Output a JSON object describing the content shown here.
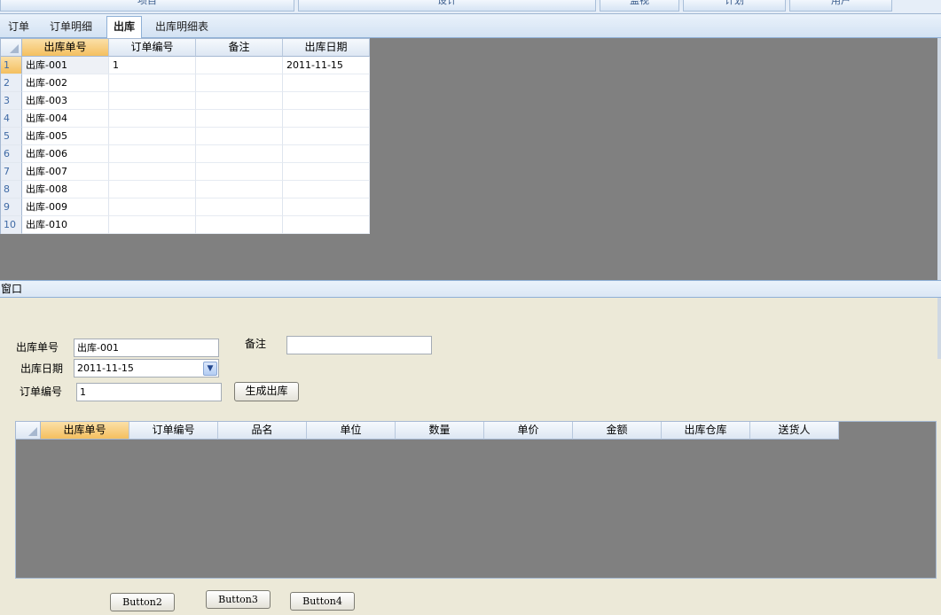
{
  "top_menu": [
    "项目",
    "设计",
    "监视",
    "计划",
    "用户"
  ],
  "tabs": [
    "订单",
    "订单明细",
    "出库",
    "出库明细表"
  ],
  "active_tab": "出库",
  "grid1": {
    "columns": [
      "出库单号",
      "订单编号",
      "备注",
      "出库日期"
    ],
    "rows": [
      {
        "num": "1",
        "cells": [
          "出库-001",
          "1",
          "",
          "2011-11-15"
        ]
      },
      {
        "num": "2",
        "cells": [
          "出库-002",
          "",
          "",
          ""
        ]
      },
      {
        "num": "3",
        "cells": [
          "出库-003",
          "",
          "",
          ""
        ]
      },
      {
        "num": "4",
        "cells": [
          "出库-004",
          "",
          "",
          ""
        ]
      },
      {
        "num": "5",
        "cells": [
          "出库-005",
          "",
          "",
          ""
        ]
      },
      {
        "num": "6",
        "cells": [
          "出库-006",
          "",
          "",
          ""
        ]
      },
      {
        "num": "7",
        "cells": [
          "出库-007",
          "",
          "",
          ""
        ]
      },
      {
        "num": "8",
        "cells": [
          "出库-008",
          "",
          "",
          ""
        ]
      },
      {
        "num": "9",
        "cells": [
          "出库-009",
          "",
          "",
          ""
        ]
      },
      {
        "num": "10",
        "cells": [
          "出库-010",
          "",
          "",
          ""
        ]
      }
    ]
  },
  "window": {
    "title": "窗口"
  },
  "form": {
    "outbound_no_label": "出库单号",
    "outbound_no_value": "出库-001",
    "remark_label": "备注",
    "remark_value": "",
    "date_label": "出库日期",
    "date_value": "2011-11-15",
    "order_no_label": "订单编号",
    "order_no_value": "1",
    "generate_button": "生成出库"
  },
  "grid2": {
    "columns": [
      "出库单号",
      "订单编号",
      "品名",
      "单位",
      "数量",
      "单价",
      "金额",
      "出库仓库",
      "送货人"
    ]
  },
  "buttons": {
    "b2": "Button2",
    "b3": "Button3",
    "b4": "Button4"
  },
  "colors": {
    "header_selected": "#f4bf5f",
    "empty_area": "#808080",
    "form_bg": "#ece9d8"
  }
}
